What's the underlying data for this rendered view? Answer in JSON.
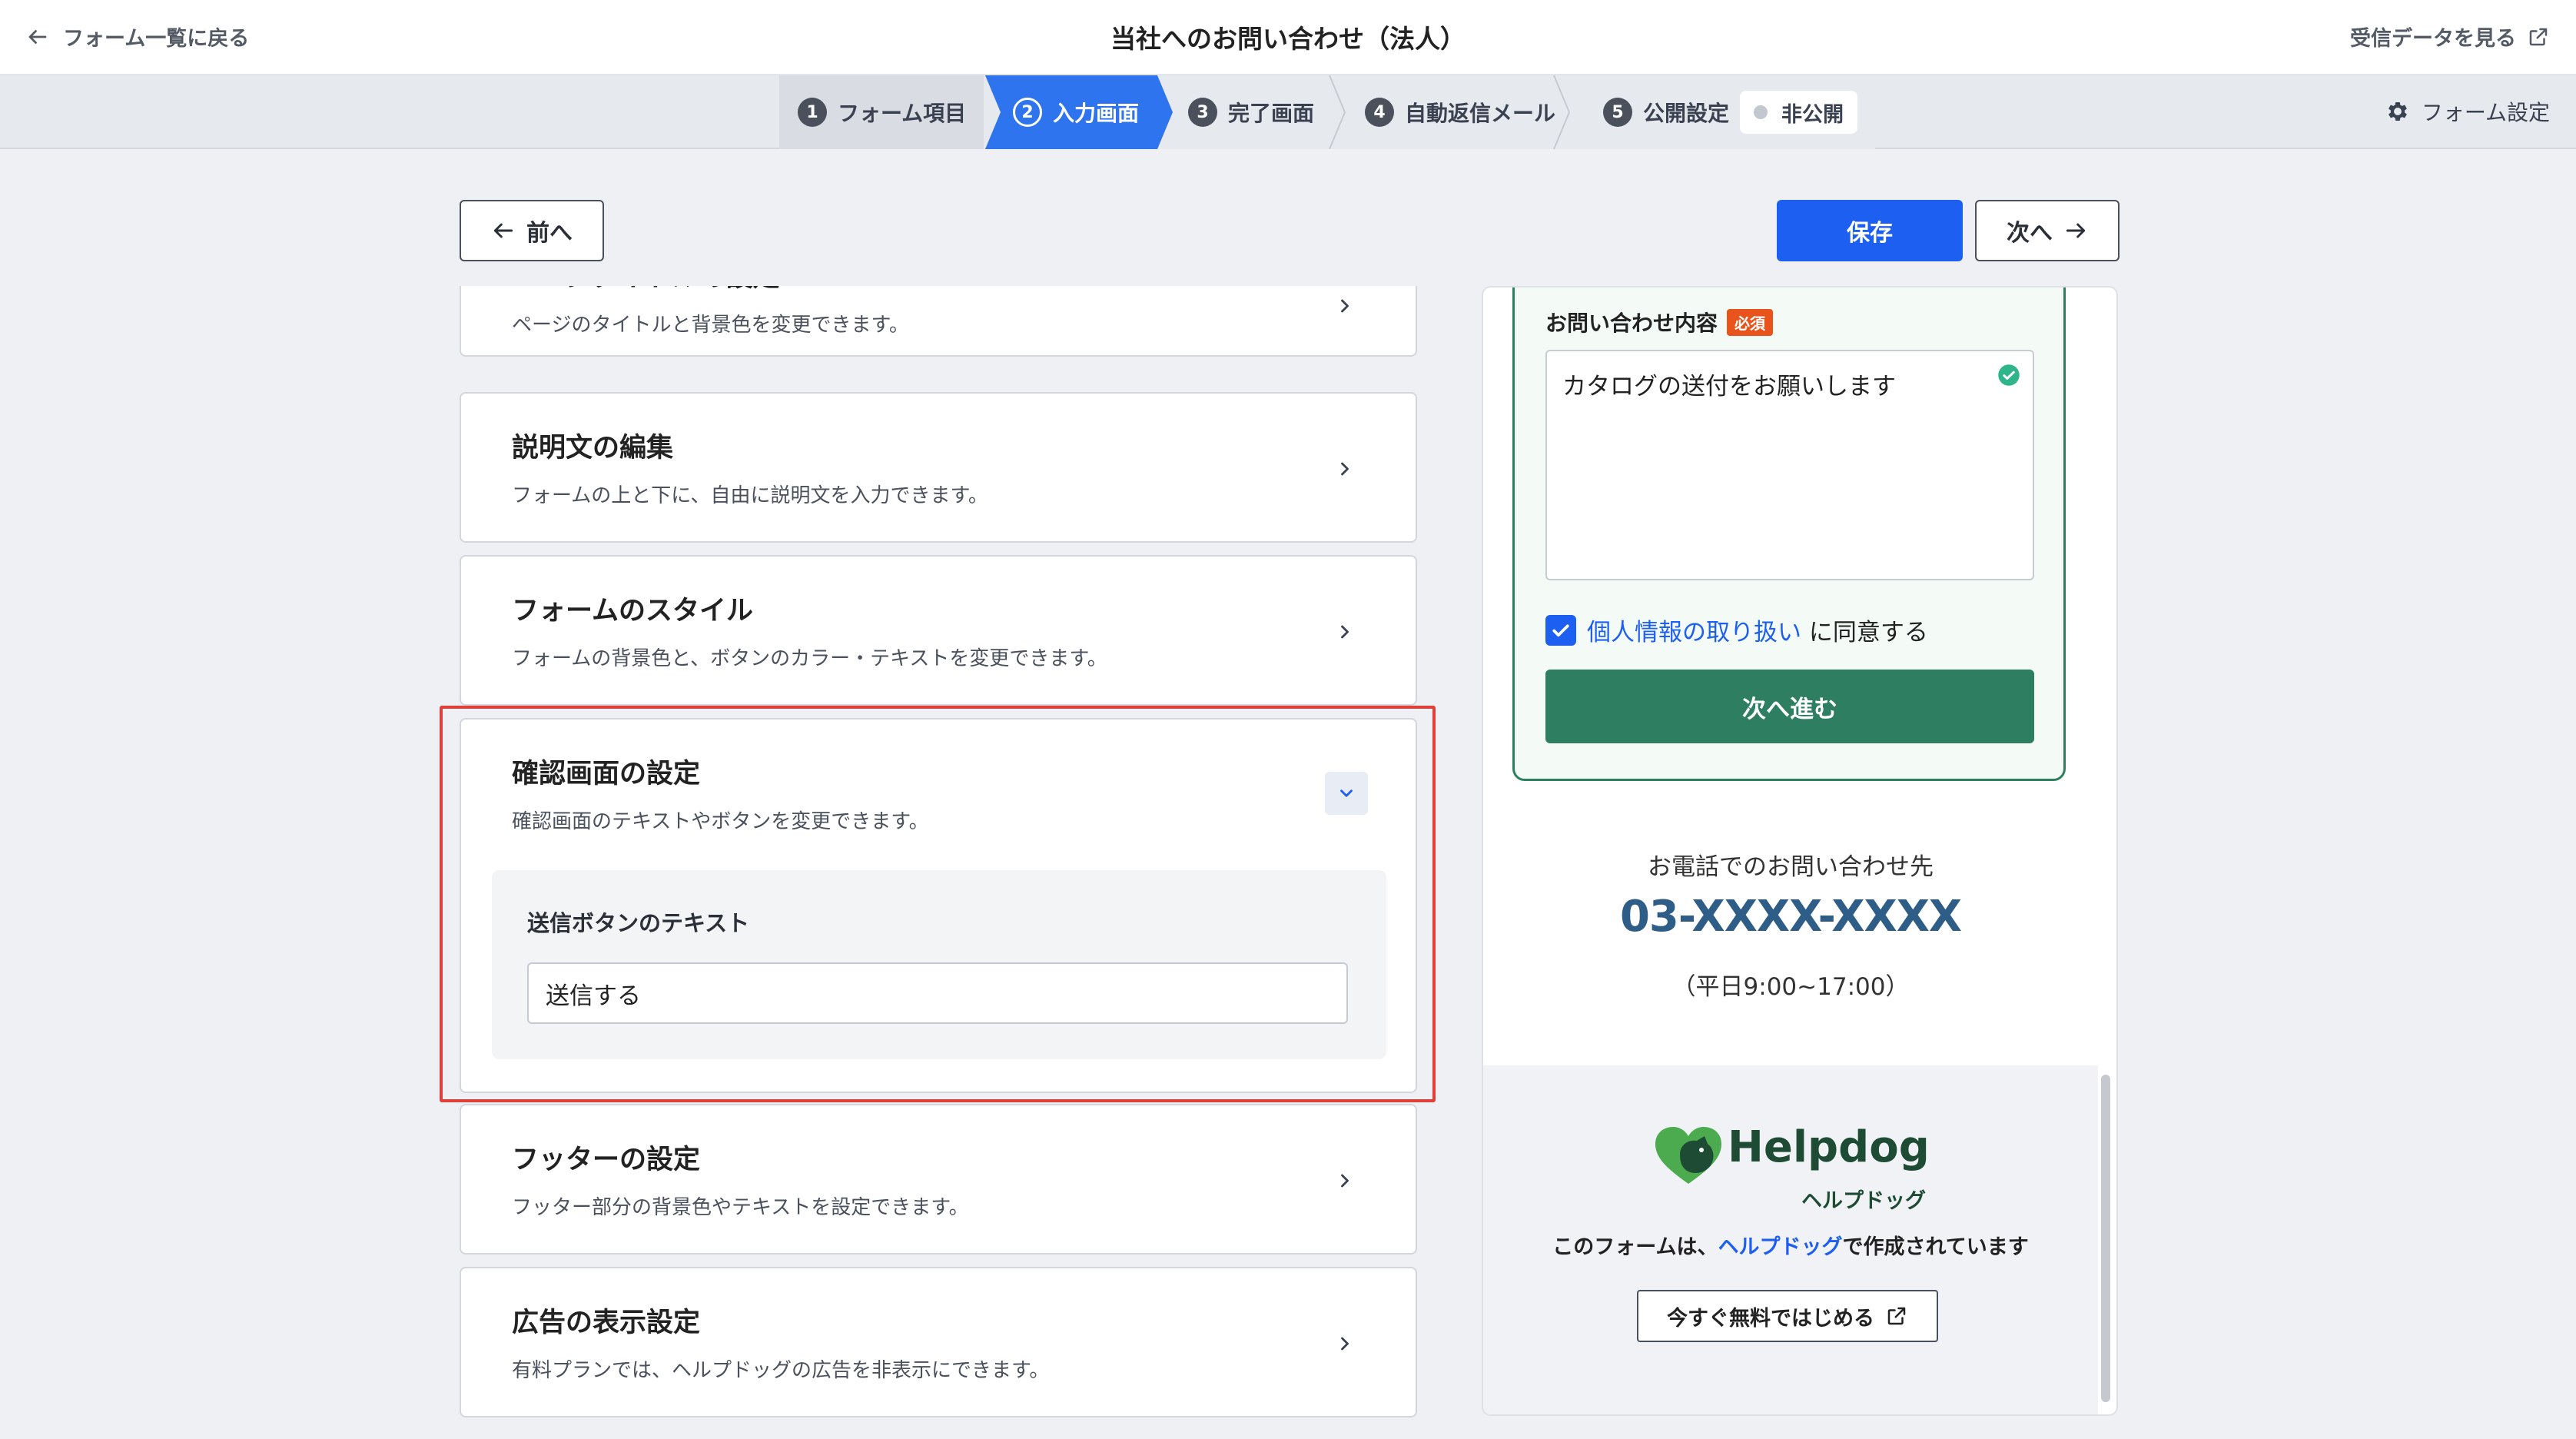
{
  "header": {
    "back_label": "フォーム一覧に戻る",
    "title": "当社へのお問い合わせ（法人）",
    "view_data_label": "受信データを見る"
  },
  "steps": [
    {
      "num": "1",
      "label": "フォーム項目",
      "active": false
    },
    {
      "num": "2",
      "label": "入力画面",
      "active": true
    },
    {
      "num": "3",
      "label": "完了画面",
      "active": false
    },
    {
      "num": "4",
      "label": "自動返信メール",
      "active": false
    },
    {
      "num": "5",
      "label": "公開設定",
      "active": false
    }
  ],
  "publish_status": "非公開",
  "form_settings_label": "フォーム設定",
  "nav": {
    "prev_label": "前へ",
    "save_label": "保存",
    "next_label": "次へ"
  },
  "settings_cards": [
    {
      "title": "ページタイトルの設定",
      "desc": "ページのタイトルと背景色を変更できます。"
    },
    {
      "title": "説明文の編集",
      "desc": "フォームの上と下に、自由に説明文を入力できます。"
    },
    {
      "title": "フォームのスタイル",
      "desc": "フォームの背景色と、ボタンのカラー・テキストを変更できます。"
    },
    {
      "title": "確認画面の設定",
      "desc": "確認画面のテキストやボタンを変更できます。",
      "expanded": true
    },
    {
      "title": "フッターの設定",
      "desc": "フッター部分の背景色やテキストを設定できます。"
    },
    {
      "title": "広告の表示設定",
      "desc": "有料プランでは、ヘルプドッグの広告を非表示にできます。"
    }
  ],
  "confirm_settings": {
    "field_label": "送信ボタンのテキスト",
    "field_value": "送信する"
  },
  "preview": {
    "field_label": "お問い合わせ内容",
    "required_badge": "必須",
    "textarea_value": "カタログの送付をお願いします",
    "consent_link": "個人情報の取り扱い",
    "consent_suffix": " に同意する",
    "next_button": "次へ進む",
    "contact_heading": "お電話でのお問い合わせ先",
    "phone": "03-XXXX-XXXX",
    "hours": "（平日9:00~17:00）",
    "logo_text": "Helpdog",
    "logo_sub": "ヘルプドッグ",
    "made_by_prefix": "このフォームは、",
    "made_by_link": "ヘルプドッグ",
    "made_by_suffix": "で作成されています",
    "start_button": "今すぐ無料ではじめる"
  },
  "colors": {
    "primary": "#1d5ff0",
    "form_green": "#2e7e61",
    "phone_blue": "#2e5d87",
    "highlight_red": "#e0403a",
    "badge_orange": "#e8541c"
  }
}
